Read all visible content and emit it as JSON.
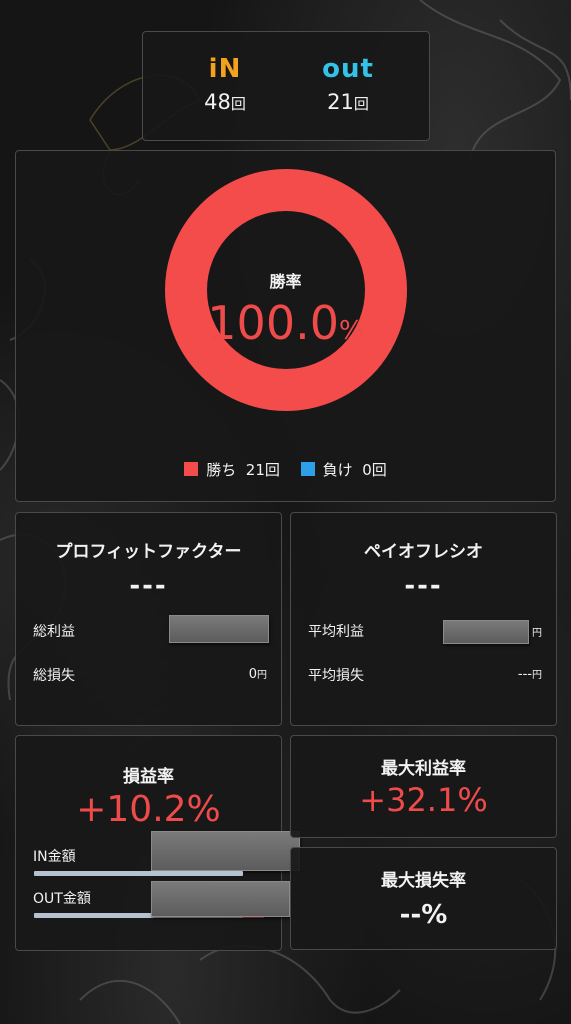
{
  "summary": {
    "in_label": "iN",
    "in_count": "48",
    "out_label": "out",
    "out_count": "21",
    "count_unit": "回"
  },
  "win_rate": {
    "label": "勝率",
    "value": "100.0",
    "unit": "%",
    "legend": [
      {
        "name": "勝ち",
        "count": "21回",
        "color": "#f44b4b"
      },
      {
        "name": "負け",
        "count": "0回",
        "color": "#2ea0ea"
      }
    ]
  },
  "chart_data": {
    "type": "pie",
    "categories": [
      "勝ち",
      "負け"
    ],
    "values": [
      21,
      0
    ],
    "colors": [
      "#f44b4b",
      "#2ea0ea"
    ]
  },
  "profit_factor": {
    "title": "プロフィットファクター",
    "value": "---",
    "total_profit_label": "総利益",
    "total_loss_label": "総損失",
    "total_loss_value": "0",
    "yen": "円"
  },
  "payoff_ratio": {
    "title": "ペイオフレシオ",
    "value": "---",
    "avg_profit_label": "平均利益",
    "avg_loss_label": "平均損失",
    "avg_loss_value": "---",
    "yen": "円"
  },
  "pnl_ratio": {
    "title": "損益率",
    "value": "+10.2%",
    "in_amount_label": "IN金額",
    "out_amount_label": "OUT金額",
    "in_bar_fraction": 0.91,
    "out_bar_fraction": 1.0,
    "out_bar_profit_fraction": 0.09
  },
  "max_profit": {
    "title": "最大利益率",
    "value": "+32.1%"
  },
  "max_loss": {
    "title": "最大損失率",
    "value": "--%"
  },
  "colors": {
    "accent_red": "#f04b4b",
    "in_orange": "#f4a21d",
    "out_cyan": "#34c3e8",
    "loss_blue": "#2ea0ea"
  }
}
